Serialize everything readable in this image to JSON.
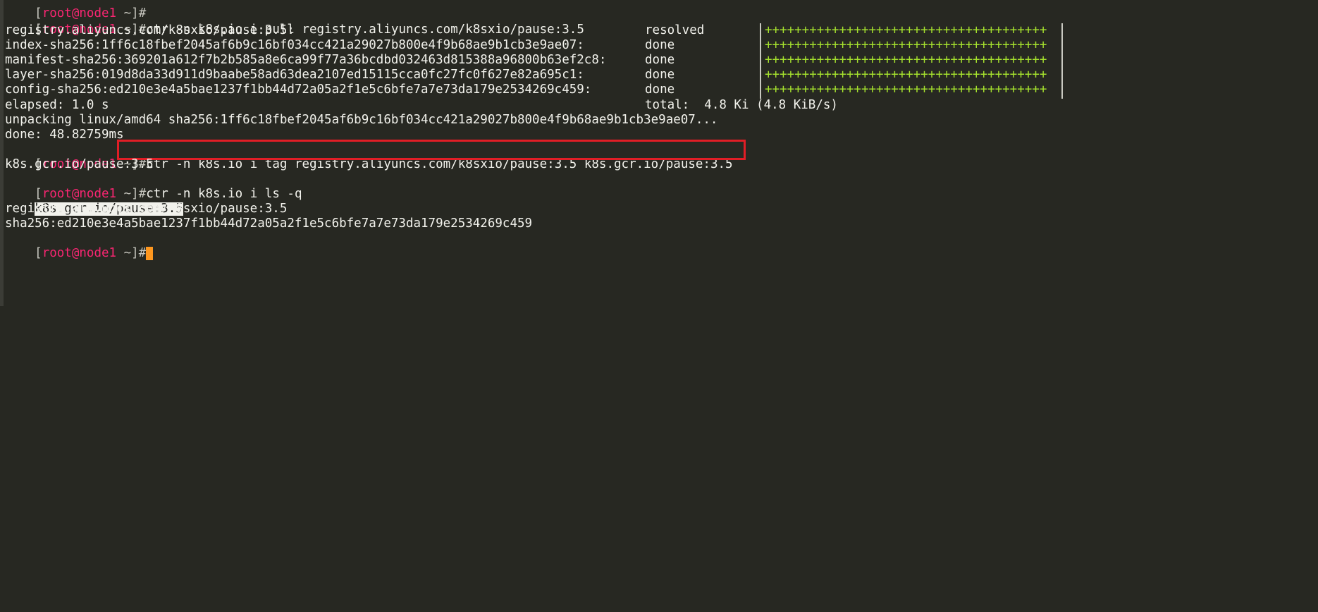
{
  "prompt": {
    "open": "[",
    "user_host": "root@node1",
    "cwd": " ~",
    "close": "]",
    "symbol": "#"
  },
  "commands": {
    "pull": "ctr -n k8s.io i pull registry.aliyuncs.com/k8sxio/pause:3.5",
    "tag": "ctr -n k8s.io i tag registry.aliyuncs.com/k8sxio/pause:3.5 k8s.gcr.io/pause:3.5",
    "ls": "ctr -n k8s.io i ls -q"
  },
  "pull_output": {
    "rows": [
      {
        "ref": "registry.aliyuncs.com/k8sxio/pause:3.5:",
        "status": "resolved",
        "progress": "++++++++++++++++++++++++++++++++++++++"
      },
      {
        "ref": "index-sha256:1ff6c18fbef2045af6b9c16bf034cc421a29027b800e4f9b68ae9b1cb3e9ae07:",
        "status": "done",
        "progress": "++++++++++++++++++++++++++++++++++++++"
      },
      {
        "ref": "manifest-sha256:369201a612f7b2b585a8e6ca99f77a36bcdbd032463d815388a96800b63ef2c8:",
        "status": "done",
        "progress": "++++++++++++++++++++++++++++++++++++++"
      },
      {
        "ref": "layer-sha256:019d8da33d911d9baabe58ad63dea2107ed15115cca0fc27fc0f627e82a695c1:",
        "status": "done",
        "progress": "++++++++++++++++++++++++++++++++++++++"
      },
      {
        "ref": "config-sha256:ed210e3e4a5bae1237f1bb44d72a05a2f1e5c6bfe7a7e73da179e2534269c459:",
        "status": "done",
        "progress": "++++++++++++++++++++++++++++++++++++++"
      }
    ],
    "elapsed": "elapsed: 1.0 s",
    "total": "total:  4.8 Ki (4.8 KiB/s)",
    "unpacking": "unpacking linux/amd64 sha256:1ff6c18fbef2045af6b9c16bf034cc421a29027b800e4f9b68ae9b1cb3e9ae07...",
    "done": "done: 48.82759ms"
  },
  "tag_output": "k8s.gcr.io/pause:3.5",
  "ls_output": [
    "k8s.gcr.io/pause:3.5",
    "registry.aliyuncs.com/k8sxio/pause:3.5",
    "sha256:ed210e3e4a5bae1237f1bb44d72a05a2f1e5c6bfe7a7e73da179e2534269c459"
  ],
  "colors": {
    "background": "#272822",
    "text": "#f2f2ec",
    "user_host": "#f92672",
    "progress": "#a6e22e",
    "highlight_box": "#e01e26",
    "cursor": "#fd971f"
  }
}
